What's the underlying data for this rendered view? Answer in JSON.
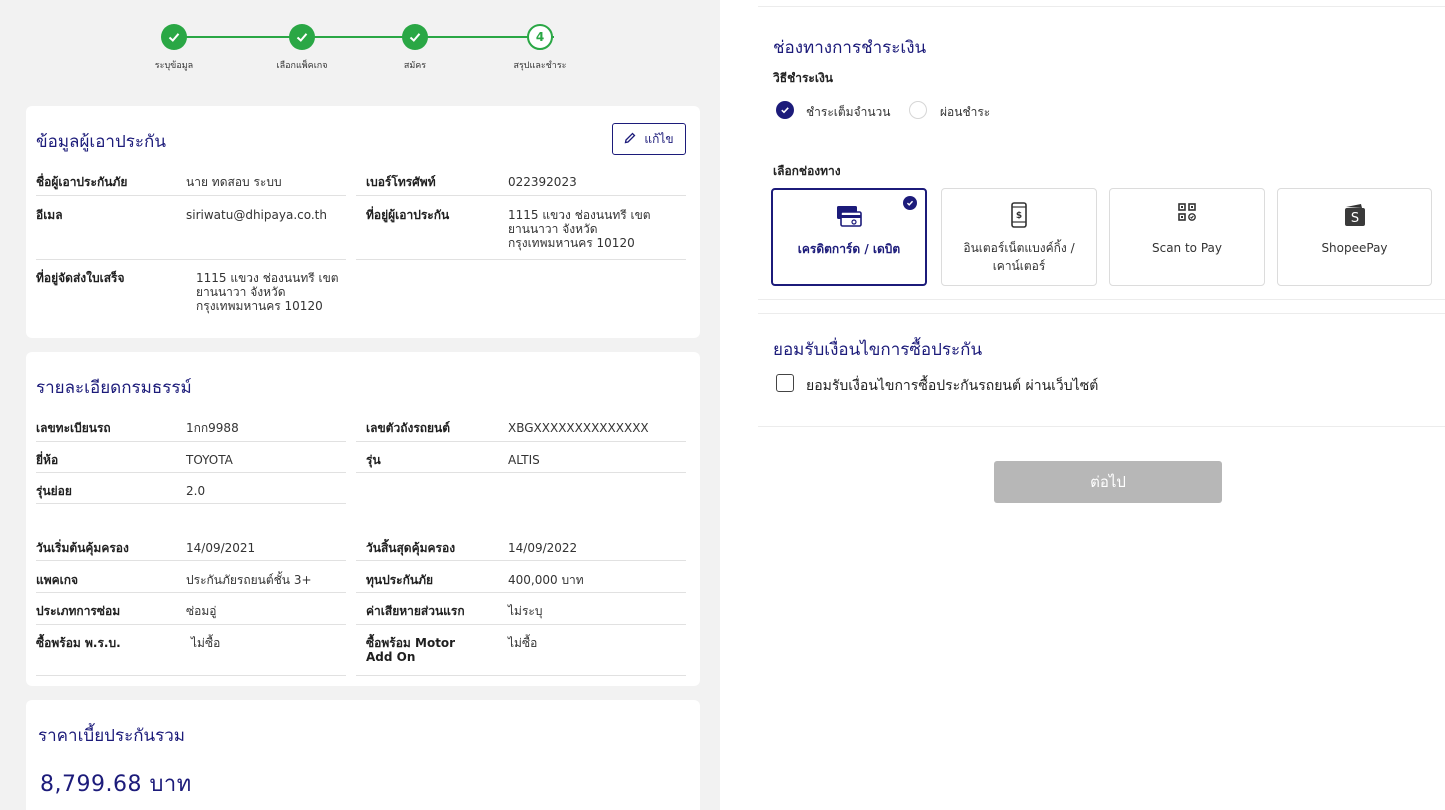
{
  "stepper": {
    "steps": [
      {
        "label": "ระบุข้อมูล",
        "state": "done"
      },
      {
        "label": "เลือกแพ็คเกจ",
        "state": "done"
      },
      {
        "label": "สมัคร",
        "state": "done"
      },
      {
        "label": "สรุปและชำระ",
        "state": "current",
        "number": "4"
      }
    ]
  },
  "insured": {
    "title": "ข้อมูลผู้เอาประกัน",
    "edit_label": "แก้ไข",
    "name_label": "ชื่อผู้เอาประกันภัย",
    "name_value": "นาย ทดสอบ ระบบ",
    "phone_label": "เบอร์โทรศัพท์",
    "phone_value": "022392023",
    "email_label": "อีเมล",
    "email_value": "siriwatu@dhipaya.co.th",
    "address_label": "ที่อยู่ผู้เอาประกัน",
    "address_value": "1115 แขวง ช่องนนทรี เขต ยานนาวา จังหวัด กรุงเทพมหานคร 10120",
    "receipt_label": "ที่อยู่จัดส่งใบเสร็จ",
    "receipt_value": "1115 แขวง ช่องนนทรี เขต ยานนาวา จังหวัด กรุงเทพมหานคร 10120"
  },
  "policy": {
    "title": "รายละเอียดกรมธรรม์",
    "plate_label": "เลขทะเบียนรถ",
    "plate_value": "1กก9988",
    "chassis_label": "เลขตัวถังรถยนต์",
    "chassis_value": "XBGXXXXXXXXXXXXXX",
    "brand_label": "ยี่ห้อ",
    "brand_value": "TOYOTA",
    "model_label": "รุ่น",
    "model_value": "ALTIS",
    "submodel_label": "รุ่นย่อย",
    "submodel_value": "2.0",
    "start_label": "วันเริ่มต้นคุ้มครอง",
    "start_value": "14/09/2021",
    "end_label": "วันสิ้นสุดคุ้มครอง",
    "end_value": "14/09/2022",
    "package_label": "แพคเกจ",
    "package_value": "ประกันภัยรถยนต์ชั้น 3+",
    "sum_label": "ทุนประกันภัย",
    "sum_value": "400,000 บาท",
    "repair_label": "ประเภทการซ่อม",
    "repair_value": "ซ่อมอู่",
    "deductible_label": "ค่าเสียหายส่วนแรก",
    "deductible_value": "ไม่ระบุ",
    "prb_label": "ซื้อพร้อม พ.ร.บ.",
    "prb_value": "ไม่ซื้อ",
    "addon_label": "ซื้อพร้อม Motor Add On",
    "addon_value": "ไม่ซื้อ"
  },
  "premium": {
    "title": "ราคาเบี้ยประกันรวม",
    "value": "8,799.68 บาท"
  },
  "payment": {
    "title": "ช่องทางการชำระเงิน",
    "method_title": "วิธีชำระเงิน",
    "full_label": "ชำระเต็มจำนวน",
    "installment_label": "ผ่อนชำระ",
    "channel_title": "เลือกช่องทาง",
    "channels": [
      {
        "label": "เครดิตการ์ด / เดบิต",
        "icon": "credit-card-icon",
        "selected": true
      },
      {
        "label": "อินเตอร์เน็ตแบงค์กิ้ง / เคาน์เตอร์",
        "icon": "mobile-banking-icon",
        "selected": false
      },
      {
        "label": "Scan to Pay",
        "icon": "qr-code-icon",
        "selected": false
      },
      {
        "label": "ShopeePay",
        "icon": "shopeepay-icon",
        "selected": false
      }
    ]
  },
  "terms": {
    "title": "ยอมรับเงื่อนไขการซื้อประกัน",
    "agree_label": "ยอมรับเงื่อนไขการซื้อประกันรถยนต์ ผ่านเว็บไซต์"
  },
  "next_label": "ต่อไป",
  "colors": {
    "primary": "#1c1b7a",
    "success": "#2aa745",
    "disabled": "#b7b7b7"
  }
}
